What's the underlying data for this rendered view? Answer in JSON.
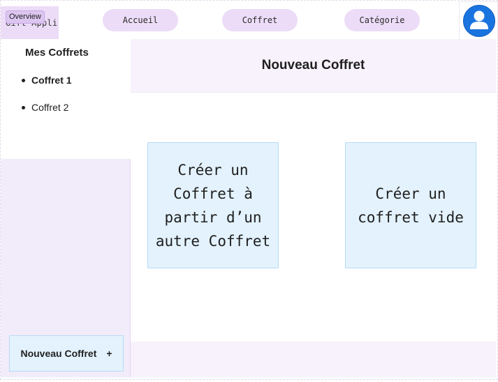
{
  "app": {
    "logo_text": "Gift Appli",
    "overview_badge": "Overview"
  },
  "nav": {
    "items": [
      "Accueil",
      "Coffret",
      "Catégorie"
    ]
  },
  "sidebar": {
    "title": "Mes Coffrets",
    "items": [
      {
        "label": "Coffret 1",
        "active": true
      },
      {
        "label": "Coffret 2",
        "active": false
      }
    ],
    "new_button_label": "Nouveau Coffret",
    "new_button_icon": "+"
  },
  "main": {
    "title": "Nouveau Coffret",
    "cards": [
      {
        "label": "Créer un Coffret à partir d’un autre Coffret"
      },
      {
        "label": "Créer un coffret vide"
      }
    ]
  },
  "colors": {
    "accent_lavender": "#ecdcf7",
    "card_blue": "#e3f2fd",
    "avatar_blue": "#1a74e0"
  },
  "icons": {
    "avatar": "user-avatar-icon",
    "add": "plus-icon"
  }
}
